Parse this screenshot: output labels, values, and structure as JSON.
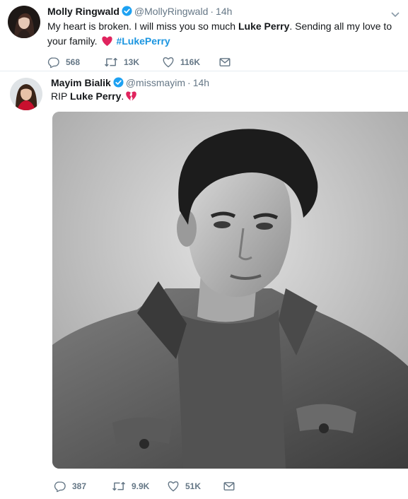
{
  "tweets": [
    {
      "name": "Molly Ringwald",
      "handle": "@MollyRingwald",
      "separator": "·",
      "time": "14h",
      "text_part1": "My heart is broken. I will miss you so much ",
      "text_bold": "Luke Perry",
      "text_part2": ".  Sending all my love to your family. ",
      "hashtag": "#LukePerry",
      "replies": "568",
      "retweets": "13K",
      "likes": "116K"
    },
    {
      "name": "Mayim Bialik",
      "handle": "@missmayim",
      "separator": "·",
      "time": "14h",
      "text_part1": "RIP ",
      "text_bold": "Luke Perry",
      "text_part2": ".",
      "replies": "387",
      "retweets": "9.9K",
      "likes": "51K"
    }
  ],
  "colors": {
    "text": "#14171a",
    "secondary": "#657786",
    "link": "#1b95e0",
    "verified": "#1da1f2",
    "heart_red": "#e0245e"
  },
  "icons": [
    "verified-badge-icon",
    "chevron-down-icon",
    "reply-icon",
    "retweet-icon",
    "like-icon",
    "direct-message-icon",
    "red-heart-emoji",
    "broken-heart-emoji"
  ]
}
